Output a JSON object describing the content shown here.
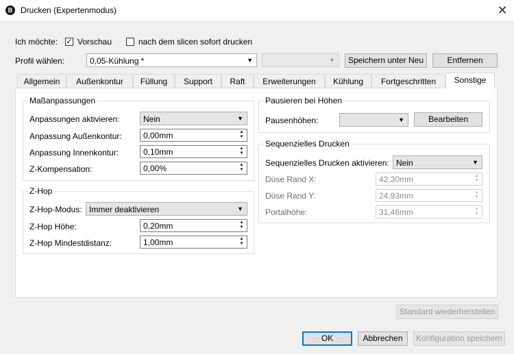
{
  "window": {
    "title": "Drucken (Expertenmodus)",
    "icon_letter": "B",
    "close": "✕"
  },
  "top": {
    "want_label": "Ich möchte:",
    "preview_label": "Vorschau",
    "preview_checked": "✓",
    "print_after_slice_label": "nach dem slicen sofort drucken",
    "profile_label": "Profil wählen:",
    "profile_value": "0,05-Kühlung *",
    "save_as_label": "Speichern unter Neu",
    "remove_label": "Entfernen"
  },
  "tabs": [
    {
      "label": "Allgemein"
    },
    {
      "label": "Außenkontur"
    },
    {
      "label": "Füllung"
    },
    {
      "label": "Support"
    },
    {
      "label": "Raft"
    },
    {
      "label": "Erweiterungen"
    },
    {
      "label": "Kühlung"
    },
    {
      "label": "Fortgeschritten"
    },
    {
      "label": "Sonstige"
    }
  ],
  "dimension": {
    "title": "Maßanpassungen",
    "enable_label": "Anpassungen aktivieren:",
    "enable_value": "Nein",
    "outer_label": "Anpassung Außenkontur:",
    "outer_value": "0,00mm",
    "inner_label": "Anpassung Innenkontur:",
    "inner_value": "0,10mm",
    "z_comp_label": "Z-Kompensation:",
    "z_comp_value": "0,00%"
  },
  "zhop": {
    "title": "Z-Hop",
    "mode_label": "Z-Hop-Modus:",
    "mode_value": "Immer deaktivieren",
    "height_label": "Z-Hop Höhe:",
    "height_value": "0,20mm",
    "min_dist_label": "Z-Hop Mindestdistanz:",
    "min_dist_value": "1,00mm"
  },
  "pause": {
    "title": "Pausieren bei Höhen",
    "heights_label": "Pausenhöhen:",
    "edit_label": "Bearbeiten"
  },
  "sequential": {
    "title": "Sequenzielles Drucken",
    "enable_label": "Sequenzielles Drucken aktivieren:",
    "enable_value": "Nein",
    "nozzle_x_label": "Düse Rand X:",
    "nozzle_x_value": "42,30mm",
    "nozzle_y_label": "Düse Rand Y:",
    "nozzle_y_value": "24,93mm",
    "portal_label": "Portalhöhe:",
    "portal_value": "31,46mm"
  },
  "bottom": {
    "restore_label": "Standard wiederherstellen",
    "ok_label": "OK",
    "cancel_label": "Abbrechen",
    "save_config_label": "Konfiguration speichern"
  }
}
